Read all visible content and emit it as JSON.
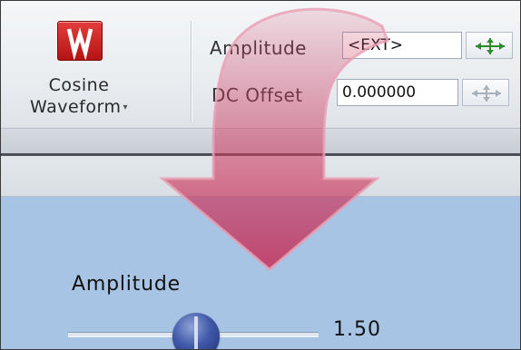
{
  "ribbon": {
    "waveform_button": {
      "line1": "Cosine",
      "line2": "Waveform",
      "caret": "▾",
      "icon": "waveform-icon"
    },
    "amplitude": {
      "label": "Amplitude",
      "value": "<EXT>",
      "control_icon": "spin-arrows-icon"
    },
    "dc_offset": {
      "label": "DC Offset",
      "value": "0.000000",
      "control_icon": "spin-arrows-icon"
    }
  },
  "panel": {
    "amplitude_label": "Amplitude",
    "slider_value": "1.50"
  },
  "colors": {
    "arrow": "#cf3f66",
    "panel_bg": "#a8c4e4",
    "waveform_icon": "#cc2222"
  }
}
